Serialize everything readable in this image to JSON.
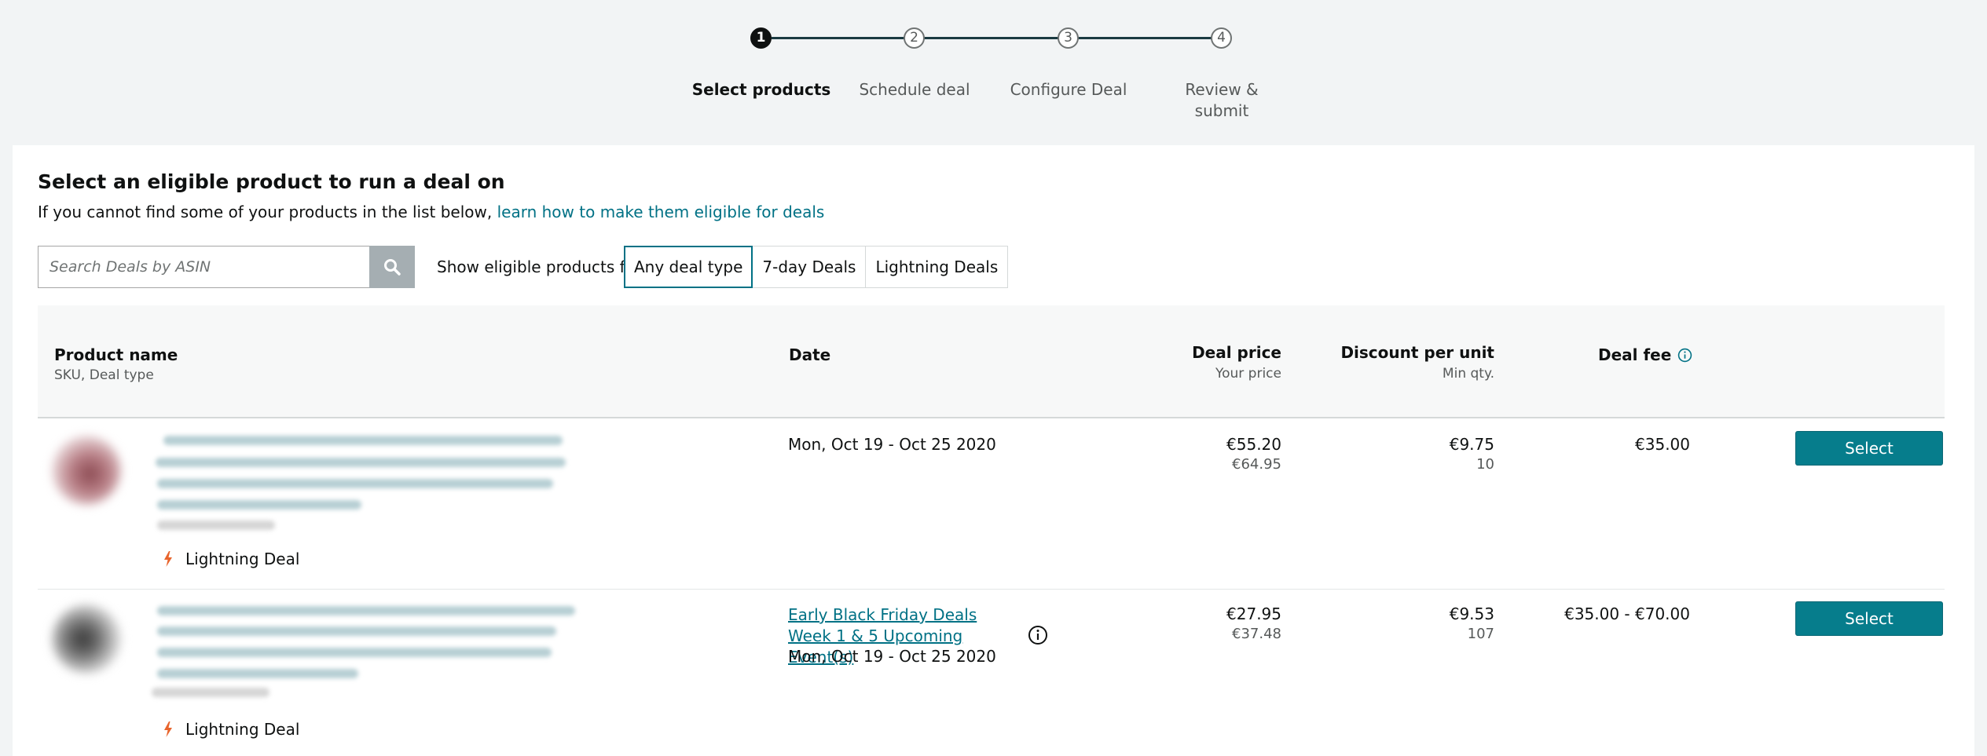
{
  "stepper": {
    "steps": [
      {
        "number": "1",
        "label": "Select products",
        "active": true
      },
      {
        "number": "2",
        "label": "Schedule deal",
        "active": false
      },
      {
        "number": "3",
        "label": "Configure Deal",
        "active": false
      },
      {
        "number": "4",
        "label": "Review & submit",
        "active": false
      }
    ]
  },
  "main": {
    "title": "Select an eligible product to run a deal on",
    "subtitle_text": "If you cannot find some of your products in the list below, ",
    "subtitle_link": "learn how to make them eligible for deals"
  },
  "search": {
    "placeholder": "Search Deals by ASIN",
    "value": "",
    "icon": "search-icon"
  },
  "filter": {
    "label": "Show eligible products for",
    "options": [
      "Any deal type",
      "7-day Deals",
      "Lightning Deals"
    ],
    "selected": "Any deal type"
  },
  "table": {
    "headers": {
      "product": "Product name",
      "product_sub": "SKU, Deal type",
      "date": "Date",
      "deal_price": "Deal price",
      "deal_price_sub": "Your price",
      "discount": "Discount per unit",
      "discount_sub": "Min qty.",
      "fee": "Deal fee"
    },
    "rows": [
      {
        "deal_type": "Lightning Deal",
        "event": "",
        "date": "Mon, Oct 19 - Oct 25 2020",
        "deal_price": "€55.20",
        "your_price": "€64.95",
        "discount": "€9.75",
        "min_qty": "10",
        "fee": "€35.00",
        "action": "Select"
      },
      {
        "deal_type": "Lightning Deal",
        "event": "Early Black Friday Deals Week 1 & 5 Upcoming Event(s)",
        "date": "Mon, Oct 19 - Oct 25 2020",
        "deal_price": "€27.95",
        "your_price": "€37.48",
        "discount": "€9.53",
        "min_qty": "107",
        "fee": "€35.00 - €70.00",
        "action": "Select"
      }
    ]
  },
  "colors": {
    "accent": "#007185",
    "button": "#067d8c",
    "lightning": "#e8642c",
    "stepper_line": "#1b3a41"
  }
}
